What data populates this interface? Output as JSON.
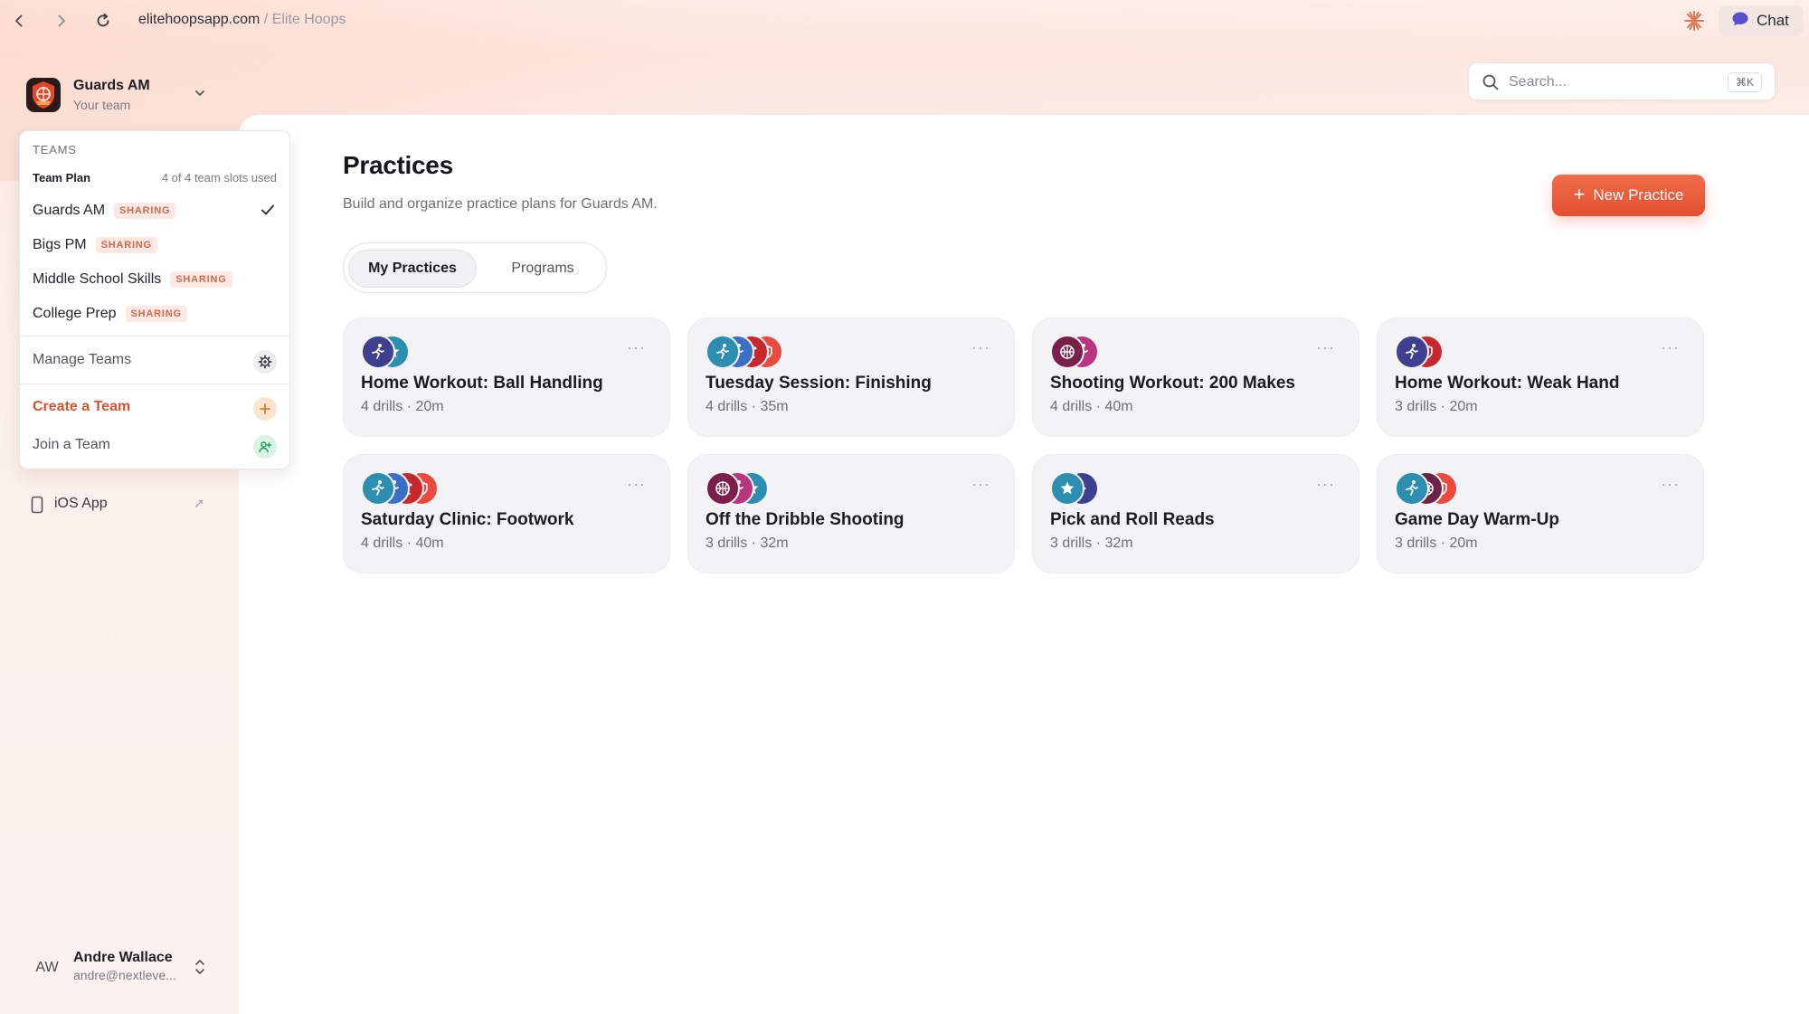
{
  "browser": {
    "url_domain": "elitehoopsapp.com",
    "url_separator": " / ",
    "url_page": "Elite Hoops",
    "chat_label": "Chat"
  },
  "team_switcher": {
    "name": "Guards AM",
    "subtitle": "Your team"
  },
  "dropdown": {
    "heading": "TEAMS",
    "plan_label": "Team Plan",
    "slots_text": "4 of 4 team slots used",
    "teams": [
      {
        "name": "Guards AM",
        "badge": "SHARING",
        "selected": true
      },
      {
        "name": "Bigs PM",
        "badge": "SHARING",
        "selected": false
      },
      {
        "name": "Middle School Skills",
        "badge": "SHARING",
        "selected": false
      },
      {
        "name": "College Prep",
        "badge": "SHARING",
        "selected": false
      }
    ],
    "manage_label": "Manage Teams",
    "create_label": "Create a Team",
    "join_label": "Join a Team"
  },
  "sidebar": {
    "ios_label": "iOS App",
    "ios_arrow": "↗"
  },
  "user": {
    "initials": "AW",
    "name": "Andre Wallace",
    "email": "andre@nextleve..."
  },
  "search": {
    "placeholder": "Search...",
    "shortcut": "⌘K"
  },
  "page": {
    "title": "Practices",
    "subtitle": "Build and organize practice plans for Guards AM.",
    "new_button": "New Practice",
    "plus": "+"
  },
  "tabs": [
    {
      "label": "My Practices",
      "active": true
    },
    {
      "label": "Programs",
      "active": false
    }
  ],
  "colors": {
    "accent": "#e85a38",
    "indigo": "#3f3f8f",
    "teal": "#2c8fb0",
    "blue": "#3a6fc4",
    "red": "#c6282d",
    "coral": "#ea4b3e",
    "maroon": "#7a1f4a",
    "magenta": "#b8357f",
    "wine": "#6b2347"
  },
  "practices": [
    {
      "title": "Home Workout: Ball Handling",
      "drills": "4 drills",
      "duration": "20m",
      "icons": [
        {
          "color": "#3f3f8f",
          "glyph": "runner-icon"
        },
        {
          "color": "#2c8fb0",
          "glyph": "star-icon"
        }
      ]
    },
    {
      "title": "Tuesday Session: Finishing",
      "drills": "4 drills",
      "duration": "35m",
      "icons": [
        {
          "color": "#2c8fb0",
          "glyph": "runner-icon"
        },
        {
          "color": "#3a6fc4",
          "glyph": "runner-icon"
        },
        {
          "color": "#c6282d",
          "glyph": "drill-icon"
        },
        {
          "color": "#ea4b3e",
          "glyph": "shield-icon"
        }
      ]
    },
    {
      "title": "Shooting Workout: 200 Makes",
      "drills": "4 drills",
      "duration": "40m",
      "icons": [
        {
          "color": "#7a1f4a",
          "glyph": "ball-icon"
        },
        {
          "color": "#b8357f",
          "glyph": "runner-icon"
        }
      ]
    },
    {
      "title": "Home Workout: Weak Hand",
      "drills": "3 drills",
      "duration": "20m",
      "icons": [
        {
          "color": "#3f3f8f",
          "glyph": "runner-icon"
        },
        {
          "color": "#c6282d",
          "glyph": "shield-icon"
        }
      ]
    },
    {
      "title": "Saturday Clinic: Footwork",
      "drills": "4 drills",
      "duration": "40m",
      "icons": [
        {
          "color": "#2c8fb0",
          "glyph": "runner-icon"
        },
        {
          "color": "#3a6fc4",
          "glyph": "runner-icon"
        },
        {
          "color": "#c6282d",
          "glyph": "drill-icon"
        },
        {
          "color": "#ea4b3e",
          "glyph": "shield-icon"
        }
      ]
    },
    {
      "title": "Off the Dribble Shooting",
      "drills": "3 drills",
      "duration": "32m",
      "icons": [
        {
          "color": "#7a1f4a",
          "glyph": "ball-icon"
        },
        {
          "color": "#b8357f",
          "glyph": "runner-icon"
        },
        {
          "color": "#2c8fb0",
          "glyph": "star-icon"
        }
      ]
    },
    {
      "title": "Pick and Roll Reads",
      "drills": "3 drills",
      "duration": "32m",
      "icons": [
        {
          "color": "#2c8fb0",
          "glyph": "star-icon"
        },
        {
          "color": "#3f3f8f",
          "glyph": "play-icon"
        }
      ]
    },
    {
      "title": "Game Day Warm-Up",
      "drills": "3 drills",
      "duration": "20m",
      "icons": [
        {
          "color": "#2c8fb0",
          "glyph": "runner-icon"
        },
        {
          "color": "#6b2347",
          "glyph": "ball-icon"
        },
        {
          "color": "#ea4b3e",
          "glyph": "shield-icon"
        }
      ]
    }
  ]
}
